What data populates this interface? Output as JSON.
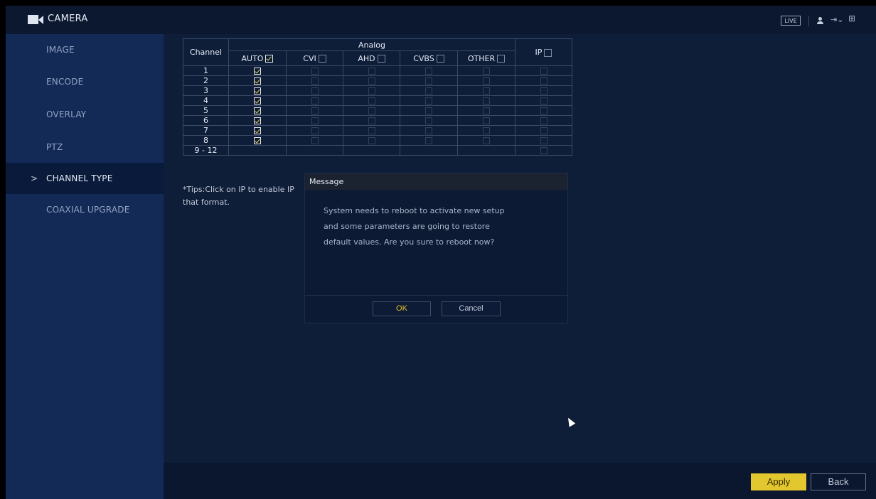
{
  "header": {
    "title": "CAMERA",
    "live_label": "LIVE",
    "icons": [
      "camera-icon",
      "user-icon",
      "exit-icon",
      "grid-icon"
    ]
  },
  "sidebar": {
    "items": [
      {
        "label": "IMAGE"
      },
      {
        "label": "ENCODE"
      },
      {
        "label": "OVERLAY"
      },
      {
        "label": "PTZ"
      },
      {
        "label": "CHANNEL TYPE",
        "active": true
      },
      {
        "label": "COAXIAL UPGRADE"
      }
    ],
    "active_marker": ">"
  },
  "table": {
    "channel_header": "Channel",
    "analog_header": "Analog",
    "columns": [
      "AUTO",
      "CVI",
      "AHD",
      "CVBS",
      "OTHER",
      "IP"
    ],
    "header_checked": {
      "AUTO": true,
      "CVI": false,
      "AHD": false,
      "CVBS": false,
      "OTHER": false,
      "IP": false
    },
    "rows": [
      {
        "channel": "1",
        "auto": true
      },
      {
        "channel": "2",
        "auto": true
      },
      {
        "channel": "3",
        "auto": true
      },
      {
        "channel": "4",
        "auto": true
      },
      {
        "channel": "5",
        "auto": true
      },
      {
        "channel": "6",
        "auto": true
      },
      {
        "channel": "7",
        "auto": true
      },
      {
        "channel": "8",
        "auto": true
      },
      {
        "channel": "9 - 12",
        "auto": false
      }
    ]
  },
  "tips": "*Tips:Click on IP to enable IP that format.",
  "tips_line1": "*Tips:Click on IP to enable IP",
  "tips_line2": "that format.",
  "dialog": {
    "title": "Message",
    "line1": "System needs to reboot to activate new setup",
    "line2": "and some parameters are going to restore",
    "line3": "default values. Are you sure to reboot now?",
    "ok_label": "OK",
    "cancel_label": "Cancel"
  },
  "footer": {
    "apply_label": "Apply",
    "back_label": "Back"
  },
  "colors": {
    "accent": "#e3c72e",
    "background": "#0e1d38",
    "sidebar": "#132a57"
  }
}
